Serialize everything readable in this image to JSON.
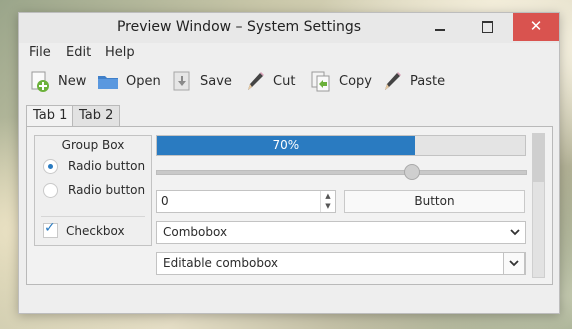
{
  "window": {
    "title": "Preview Window – System Settings",
    "close_glyph": "✕"
  },
  "menu": [
    "File",
    "Edit",
    "Help"
  ],
  "toolbar": [
    {
      "label": "New",
      "icon": "new-document-plus-icon"
    },
    {
      "label": "Open",
      "icon": "folder-icon"
    },
    {
      "label": "Save",
      "icon": "save-download-icon"
    },
    {
      "label": "Cut",
      "icon": "pencil-cut-icon"
    },
    {
      "label": "Copy",
      "icon": "copy-document-icon"
    },
    {
      "label": "Paste",
      "icon": "pencil-paste-icon"
    }
  ],
  "tabs": [
    {
      "label": "Tab 1",
      "active": true
    },
    {
      "label": "Tab 2",
      "active": false
    }
  ],
  "group_box": {
    "title": "Group Box",
    "radios": [
      {
        "label": "Radio button",
        "checked": true
      },
      {
        "label": "Radio button",
        "checked": false
      }
    ],
    "checkbox": {
      "label": "Checkbox",
      "checked": true
    }
  },
  "progress": {
    "percent": 70,
    "text": "70%"
  },
  "slider": {
    "value": 0.69
  },
  "spinbox": {
    "value": "0"
  },
  "button": {
    "label": "Button"
  },
  "combobox": {
    "value": "Combobox"
  },
  "editable_combobox": {
    "value": "Editable combobox"
  },
  "colors": {
    "accent": "#2a7bc1",
    "close": "#d9534f"
  }
}
